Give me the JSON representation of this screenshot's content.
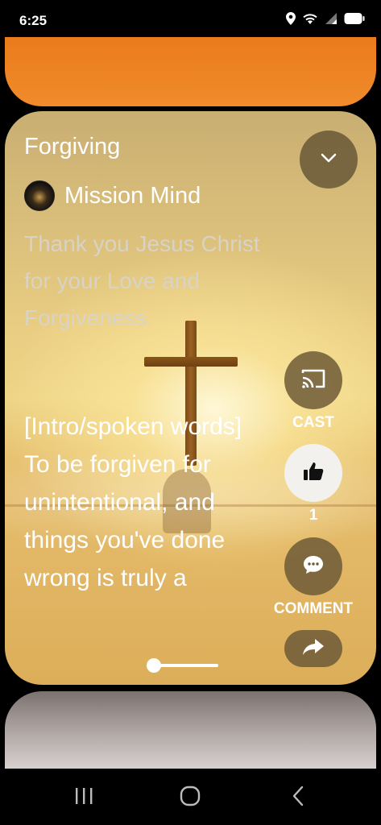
{
  "status_bar": {
    "time": "6:25",
    "icons": [
      "location-icon",
      "wifi-icon",
      "signal-icon",
      "battery-icon"
    ]
  },
  "video": {
    "title": "Forgiving",
    "channel_name": "Mission Mind",
    "description": "Thank you Jesus Christ for your Love and Forgiveness.",
    "lyrics": "[Intro/spoken words]\nTo be forgiven for unintentional, and things you've done wrong is truly a",
    "progress": 0.02
  },
  "actions": {
    "cast_label": "CAST",
    "like_count": "1",
    "comment_label": "COMMENT"
  },
  "colors": {
    "accent_orange": "#ea7b1c",
    "button_dark": "#6e5a37",
    "button_light": "#f3f1ee"
  },
  "nav": {
    "icons": [
      "recent-apps-icon",
      "home-icon",
      "back-icon"
    ]
  }
}
